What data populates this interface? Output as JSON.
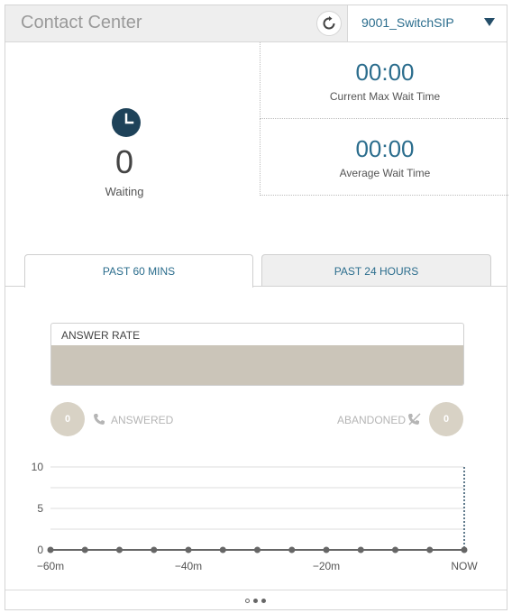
{
  "header": {
    "title": "Contact Center",
    "queue_selected": "9001_SwitchSIP"
  },
  "stats": {
    "waiting_count": "0",
    "waiting_label": "Waiting",
    "max_wait_value": "00:00",
    "max_wait_label": "Current Max Wait Time",
    "avg_wait_value": "00:00",
    "avg_wait_label": "Average Wait Time"
  },
  "tabs": [
    {
      "label": "PAST 60 MINS",
      "active": true
    },
    {
      "label": "PAST 24 HOURS",
      "active": false
    }
  ],
  "answer_rate": {
    "label": "ANSWER RATE"
  },
  "answered": {
    "count": "0",
    "label": "ANSWERED"
  },
  "abandoned": {
    "count": "0",
    "label": "ABANDONED"
  },
  "chart_data": {
    "type": "line",
    "x": [
      -60,
      -55,
      -50,
      -45,
      -40,
      -35,
      -30,
      -25,
      -20,
      -15,
      -10,
      -5,
      0
    ],
    "x_tick_labels": [
      "−60m",
      "−40m",
      "−20m",
      "NOW"
    ],
    "x_tick_values": [
      -60,
      -40,
      -20,
      0
    ],
    "y_tick_labels": [
      "10",
      "5",
      "0"
    ],
    "ylim": [
      0,
      10
    ],
    "series": [
      {
        "values": [
          0,
          0,
          0,
          0,
          0,
          0,
          0,
          0,
          0,
          0,
          0,
          0,
          0
        ]
      }
    ],
    "grid": true
  },
  "colors": {
    "accent": "#2b6d8d",
    "bar": "#cbc5b9",
    "circle": "#d8d2c5"
  },
  "pagination": {
    "pages": 3,
    "current": 1
  }
}
